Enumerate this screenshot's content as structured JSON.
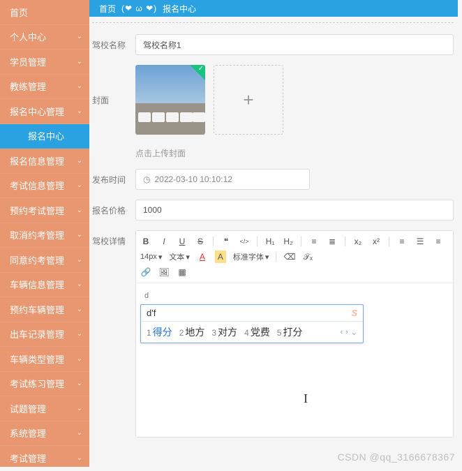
{
  "sidebar": {
    "items": [
      {
        "label": "首页",
        "chev": false
      },
      {
        "label": "个人中心",
        "chev": true
      },
      {
        "label": "学员管理",
        "chev": true
      },
      {
        "label": "教练管理",
        "chev": true
      },
      {
        "label": "报名中心管理",
        "chev": true
      },
      {
        "label": "报名中心",
        "chev": false,
        "active": true
      },
      {
        "label": "报名信息管理",
        "chev": true
      },
      {
        "label": "考试信息管理",
        "chev": true
      },
      {
        "label": "预约考试管理",
        "chev": true
      },
      {
        "label": "取消约考管理",
        "chev": true
      },
      {
        "label": "同意约考管理",
        "chev": true
      },
      {
        "label": "车辆信息管理",
        "chev": true
      },
      {
        "label": "预约车辆管理",
        "chev": true
      },
      {
        "label": "出车记录管理",
        "chev": true
      },
      {
        "label": "车辆类型管理",
        "chev": true
      },
      {
        "label": "考试练习管理",
        "chev": true
      },
      {
        "label": "试题管理",
        "chev": true
      },
      {
        "label": "系统管理",
        "chev": true
      },
      {
        "label": "考试管理",
        "chev": true
      }
    ]
  },
  "breadcrumb": {
    "home": "首页",
    "owo": "(❤ ω ❤)",
    "current": "报名中心"
  },
  "form": {
    "school_name_label": "驾校名称",
    "school_name_value": "驾校名称1",
    "cover_label": "封面",
    "upload_hint": "点击上传封面",
    "publish_label": "发布时间",
    "publish_value": "2022-03-10 10:10:12",
    "price_label": "报名价格",
    "price_value": "1000",
    "detail_label": "驾校详情"
  },
  "editor": {
    "toolbar": {
      "fontsize": "14px",
      "fontfamily": "文本",
      "stdfont": "标准字体",
      "bold": "B",
      "italic": "I",
      "underline": "U",
      "strike": "S",
      "quote": "❝",
      "code": "</>",
      "h1": "H₁",
      "h2": "H₂",
      "ul": "≡",
      "ol": "≣",
      "x2": "x₂",
      "x2sup": "x²",
      "align_l": "≡",
      "align_c": "☰",
      "align_r": "≡",
      "a_up": "A",
      "a_bg": "A",
      "eraser": "⌫",
      "script": "𝒯ₓ",
      "link": "🔗",
      "image": "🖼",
      "video": "▦"
    },
    "body_text": "d",
    "ime": {
      "input": "d'f",
      "candidates": [
        {
          "n": "1",
          "t": "得分"
        },
        {
          "n": "2",
          "t": "地方"
        },
        {
          "n": "3",
          "t": "对方"
        },
        {
          "n": "4",
          "t": "党费"
        },
        {
          "n": "5",
          "t": "打分"
        }
      ],
      "nav_prev": "‹",
      "nav_next": "›",
      "nav_more": "⌄"
    }
  },
  "watermark": "CSDN @qq_3166678367"
}
